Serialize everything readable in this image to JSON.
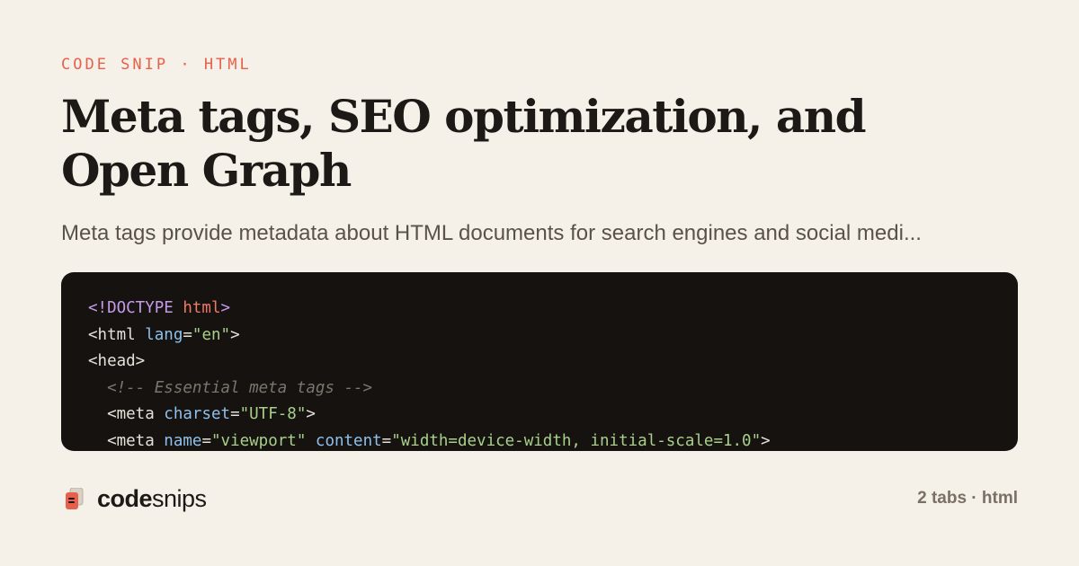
{
  "eyebrow": "CODE SNIP · HTML",
  "title": "Meta tags, SEO optimization, and Open Graph",
  "description": "Meta tags provide metadata about HTML documents for search engines and social medi...",
  "code": {
    "lines": [
      [
        {
          "t": "<!DOCTYPE ",
          "c": "doctype"
        },
        {
          "t": "html",
          "c": "tagname"
        },
        {
          "t": ">",
          "c": "doctype"
        }
      ],
      [
        {
          "t": "<html ",
          "c": "punct"
        },
        {
          "t": "lang",
          "c": "attr"
        },
        {
          "t": "=",
          "c": "punct"
        },
        {
          "t": "\"en\"",
          "c": "str"
        },
        {
          "t": ">",
          "c": "punct"
        }
      ],
      [
        {
          "t": "<head>",
          "c": "punct"
        }
      ],
      [
        {
          "t": "  <!-- Essential meta tags -->",
          "c": "comment"
        }
      ],
      [
        {
          "t": "  <meta ",
          "c": "punct"
        },
        {
          "t": "charset",
          "c": "attr"
        },
        {
          "t": "=",
          "c": "punct"
        },
        {
          "t": "\"UTF-8\"",
          "c": "str"
        },
        {
          "t": ">",
          "c": "punct"
        }
      ],
      [
        {
          "t": "  <meta ",
          "c": "punct"
        },
        {
          "t": "name",
          "c": "attr"
        },
        {
          "t": "=",
          "c": "punct"
        },
        {
          "t": "\"viewport\"",
          "c": "str"
        },
        {
          "t": " ",
          "c": "punct"
        },
        {
          "t": "content",
          "c": "attr"
        },
        {
          "t": "=",
          "c": "punct"
        },
        {
          "t": "\"width=device-width, initial-scale=1.0\"",
          "c": "str"
        },
        {
          "t": ">",
          "c": "punct"
        }
      ]
    ]
  },
  "brand": {
    "strong": "code",
    "light": "snips",
    "icon": "snippet-stack-icon",
    "accent": "#e8604c"
  },
  "meta": "2 tabs · html"
}
